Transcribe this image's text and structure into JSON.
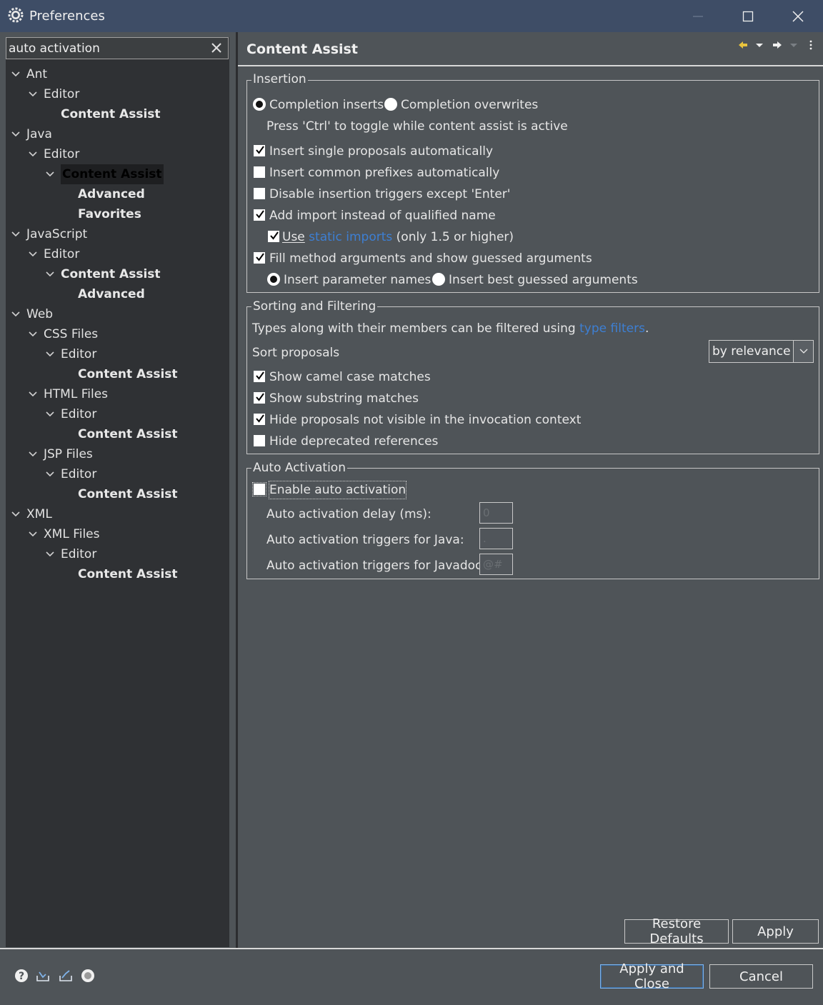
{
  "window": {
    "title": "Preferences",
    "controls": [
      "minimize-icon",
      "maximize-icon",
      "close-icon"
    ]
  },
  "search": {
    "value": "auto activation"
  },
  "tree": {
    "items": [
      {
        "label": "Ant",
        "level": 0,
        "expanded": true
      },
      {
        "label": "Editor",
        "level": 1,
        "expanded": true
      },
      {
        "label": "Content Assist",
        "level": 2,
        "bold": true
      },
      {
        "label": "Java",
        "level": 0,
        "expanded": true
      },
      {
        "label": "Editor",
        "level": 1,
        "expanded": true
      },
      {
        "label": "Content Assist",
        "level": 2,
        "bold": true,
        "selected": true,
        "expanded": true
      },
      {
        "label": "Advanced",
        "level": 3,
        "bold": true
      },
      {
        "label": "Favorites",
        "level": 3,
        "bold": true
      },
      {
        "label": "JavaScript",
        "level": 0,
        "expanded": true
      },
      {
        "label": "Editor",
        "level": 1,
        "expanded": true
      },
      {
        "label": "Content Assist",
        "level": 2,
        "bold": true,
        "expanded": true
      },
      {
        "label": "Advanced",
        "level": 3,
        "bold": true
      },
      {
        "label": "Web",
        "level": 0,
        "expanded": true
      },
      {
        "label": "CSS Files",
        "level": 1,
        "expanded": true
      },
      {
        "label": "Editor",
        "level": 2,
        "expanded": true
      },
      {
        "label": "Content Assist",
        "level": 3,
        "bold": true
      },
      {
        "label": "HTML Files",
        "level": 1,
        "expanded": true
      },
      {
        "label": "Editor",
        "level": 2,
        "expanded": true
      },
      {
        "label": "Content Assist",
        "level": 3,
        "bold": true
      },
      {
        "label": "JSP Files",
        "level": 1,
        "expanded": true
      },
      {
        "label": "Editor",
        "level": 2,
        "expanded": true
      },
      {
        "label": "Content Assist",
        "level": 3,
        "bold": true
      },
      {
        "label": "XML",
        "level": 0,
        "expanded": true
      },
      {
        "label": "XML Files",
        "level": 1,
        "expanded": true
      },
      {
        "label": "Editor",
        "level": 2,
        "expanded": true
      },
      {
        "label": "Content Assist",
        "level": 3,
        "bold": true
      }
    ]
  },
  "page": {
    "title": "Content Assist",
    "nav_icons": [
      "back-arrow-icon",
      "back-menu-icon",
      "forward-arrow-icon",
      "forward-menu-icon",
      "view-menu-icon"
    ]
  },
  "insertion": {
    "legend": "Insertion",
    "radio_inserts": "Completion inserts",
    "radio_inserts_checked": true,
    "radio_overwrites": "Completion overwrites",
    "radio_overwrites_checked": false,
    "toggle_hint": "Press 'Ctrl' to toggle while content assist is active",
    "cb_single": {
      "label": "Insert single proposals automatically",
      "checked": true
    },
    "cb_prefixes": {
      "label": "Insert common prefixes automatically",
      "checked": false
    },
    "cb_triggers": {
      "label": "Disable insertion triggers except 'Enter'",
      "checked": false
    },
    "cb_import": {
      "label": "Add import instead of qualified name",
      "checked": true
    },
    "cb_static": {
      "prefix": "Use",
      "link": "static imports",
      "suffix": "(only 1.5 or higher)",
      "checked": true
    },
    "cb_fill": {
      "label": "Fill method arguments and show guessed arguments",
      "checked": true
    },
    "radio_param_names": "Insert parameter names",
    "radio_param_names_checked": true,
    "radio_best_guessed": "Insert best guessed arguments",
    "radio_best_guessed_checked": false
  },
  "sorting": {
    "legend": "Sorting and Filtering",
    "filter_text": "Types along with their members can be filtered using",
    "filter_link": "type filters",
    "filter_end": ".",
    "sort_label": "Sort proposals",
    "sort_value": "by relevance",
    "cb_camel": {
      "label": "Show camel case matches",
      "checked": true
    },
    "cb_substring": {
      "label": "Show substring matches",
      "checked": true
    },
    "cb_hide_invisible": {
      "label": "Hide proposals not visible in the invocation context",
      "checked": true
    },
    "cb_deprecated": {
      "label": "Hide deprecated references",
      "checked": false
    }
  },
  "auto_activation": {
    "legend": "Auto Activation",
    "cb_enable": {
      "label": "Enable auto activation",
      "checked": false
    },
    "delay_label": "Auto activation delay (ms):",
    "delay_value": "0",
    "java_label": "Auto activation triggers for Java:",
    "java_value": ".",
    "javadoc_label": "Auto activation triggers for Javadoc:",
    "javadoc_value": "@#"
  },
  "buttons": {
    "restore_defaults": "Restore Defaults",
    "apply": "Apply",
    "apply_and_close": "Apply and Close",
    "cancel": "Cancel"
  },
  "footer_icons": [
    "help-icon",
    "import-icon",
    "export-icon",
    "oomph-preference-recorder-icon"
  ]
}
